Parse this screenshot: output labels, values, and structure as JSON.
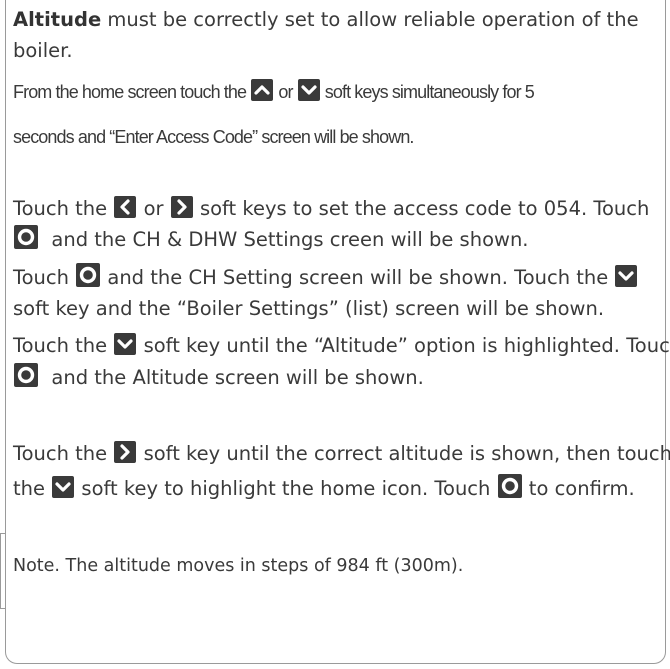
{
  "heading": {
    "bold": "Altitude",
    "rest1": "must be correctly set to allow reliable operation of the",
    "rest2": "boiler."
  },
  "step1": {
    "a": "From the home screen touch the",
    "b": "or",
    "c": "soft keys simultaneously for 5",
    "d": "seconds and “Enter Access Code” screen will be shown."
  },
  "step2": {
    "a": "Touch the",
    "b": "or",
    "c": "soft keys to set the access code to 054.  Touch",
    "d": "and the CH & DHW Settings creen will be shown."
  },
  "step3": {
    "a": "Touch",
    "b": "and the CH Setting screen will be shown.  Touch the",
    "c": "soft key and the “Boiler Settings” (list) screen will be shown."
  },
  "step4": {
    "a": "Touch the",
    "b": "soft key until the “Altitude” option is highlighted. Touch",
    "c": "and the Altitude screen will be shown."
  },
  "step5": {
    "a": "Touch the",
    "b": "soft key until the correct altitude is shown, then touch",
    "c": "the",
    "d": "soft key to highlight the home icon.  Touch",
    "e": "to confirm."
  },
  "note": "Note.  The altitude moves in steps of 984 ft (300m).",
  "key_color": "#3a3a3a",
  "icons": {
    "up": "chevron-up-icon",
    "down": "chevron-down-icon",
    "left": "chevron-left-icon",
    "right": "chevron-right-icon",
    "ok": "ok-circle-icon"
  }
}
